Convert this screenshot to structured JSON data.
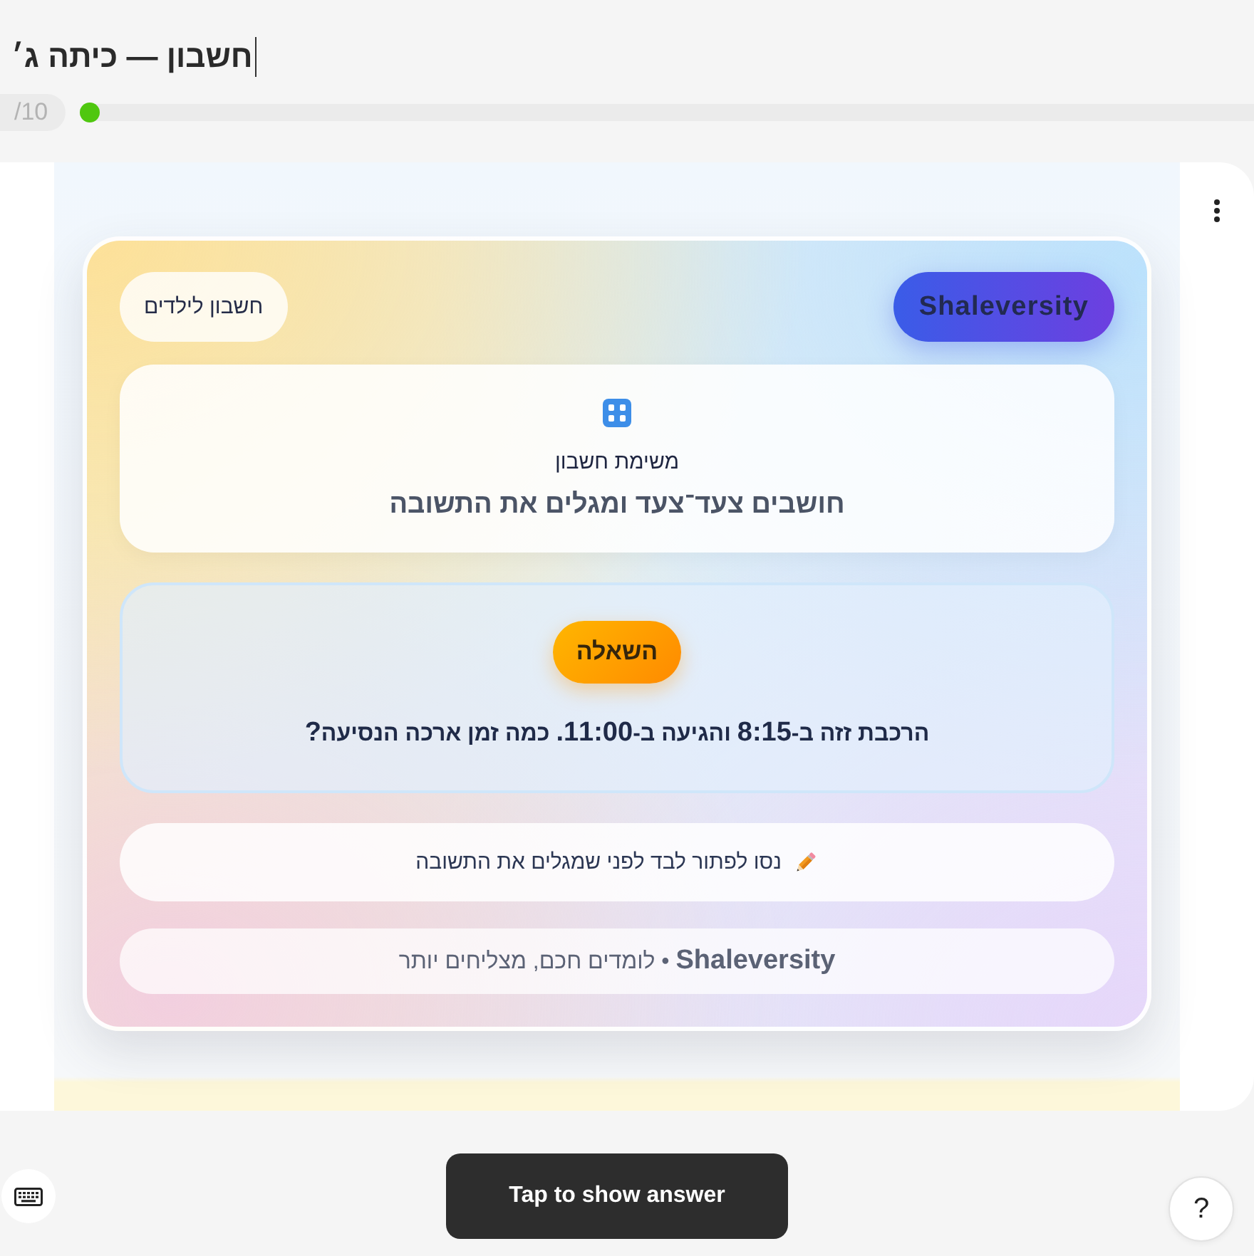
{
  "header": {
    "title": "חשבון — כיתה ג׳",
    "progress": {
      "count": "/10",
      "level": 0
    }
  },
  "card": {
    "brand": "Shaleversity",
    "badge": "חשבון לילדים",
    "intro": {
      "label": "משימת חשבון",
      "subtitle": "חושבים צעד־צעד ומגלים את התשובה"
    },
    "question": {
      "tag": "השאלה",
      "text": "הרכבת זזה ב-**8:15** והגיעה ב-**11:00.** כמה זמן ארכה הנסיעה**?**"
    },
    "hint": "נסו לפתור לבד לפני שמגלים את התשובה",
    "footer": "**Shaleversity** • לומדים חכם, מצליחים יותר"
  },
  "bottom_bar": {
    "button": "Tap to show answer",
    "help": "?"
  }
}
